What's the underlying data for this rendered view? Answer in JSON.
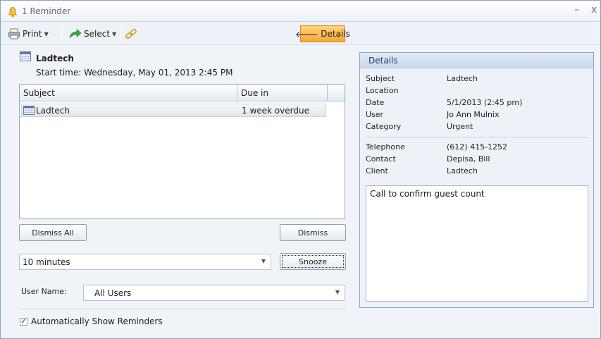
{
  "window": {
    "title": "1 Reminder",
    "minimize": "–",
    "close": "x"
  },
  "toolbar": {
    "print_label": "Print",
    "select_label": "Select",
    "details_label": "Details"
  },
  "appointment": {
    "title": "Ladtech",
    "start_time": "Start time: Wednesday, May 01, 2013 2:45 PM"
  },
  "list": {
    "columns": [
      "Subject",
      "Due in"
    ],
    "rows": [
      {
        "subject": "Ladtech",
        "due_in": "1 week overdue"
      }
    ]
  },
  "buttons": {
    "dismiss_all": "Dismiss All",
    "dismiss": "Dismiss",
    "snooze": "Snooze"
  },
  "snooze_select": {
    "value": "10 minutes"
  },
  "user_name": {
    "label": "User Name:",
    "value": "All Users"
  },
  "auto_show": {
    "label": "Automatically Show Reminders",
    "checked": true
  },
  "details": {
    "header": "Details",
    "fields": [
      {
        "label": "Subject",
        "value": "Ladtech"
      },
      {
        "label": "Location",
        "value": ""
      },
      {
        "label": "Date",
        "value": "5/1/2013 (2:45 pm)"
      },
      {
        "label": "User",
        "value": "Jo Ann Mulnix"
      },
      {
        "label": "Category",
        "value": "Urgent"
      }
    ],
    "contact_fields": [
      {
        "label": "Telephone",
        "value": "(612) 415-1252"
      },
      {
        "label": "Contact",
        "value": "Depisa, Bill"
      },
      {
        "label": "Client",
        "value": "Ladtech"
      }
    ],
    "notes": "Call to confirm guest count"
  },
  "colors": {
    "accent": "#f6a737",
    "panel_header": "#c9d9ee",
    "border": "#8fa6c6"
  }
}
